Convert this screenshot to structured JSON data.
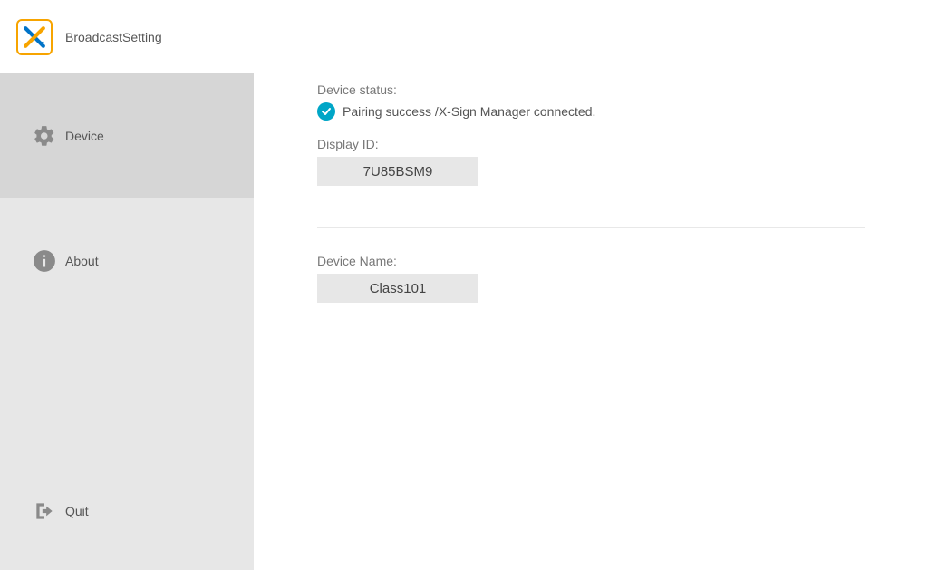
{
  "header": {
    "title": "BroadcastSetting"
  },
  "sidebar": {
    "items": [
      {
        "label": "Device"
      },
      {
        "label": "About"
      }
    ],
    "quit_label": "Quit"
  },
  "main": {
    "device_status_label": "Device status:",
    "device_status_text": "Pairing success /X-Sign Manager connected.",
    "display_id_label": "Display ID:",
    "display_id_value": "7U85BSM9",
    "device_name_label": "Device Name:",
    "device_name_value": "Class101"
  }
}
